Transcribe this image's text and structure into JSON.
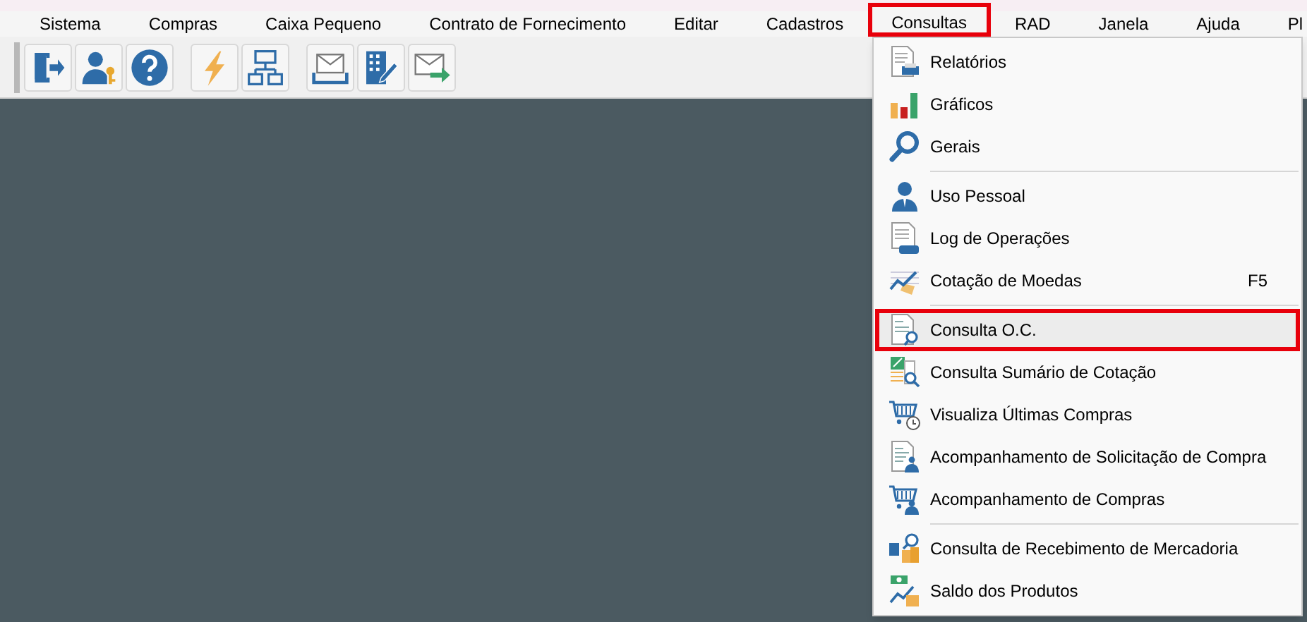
{
  "menu_bar": [
    {
      "label": "Sistema",
      "selected": false
    },
    {
      "label": "Compras",
      "selected": false
    },
    {
      "label": "Caixa Pequeno",
      "selected": false
    },
    {
      "label": "Contrato de Fornecimento",
      "selected": false
    },
    {
      "label": "Editar",
      "selected": false
    },
    {
      "label": "Cadastros",
      "selected": false
    },
    {
      "label": "Consultas",
      "selected": true
    },
    {
      "label": "RAD",
      "selected": false
    },
    {
      "label": "Janela",
      "selected": false
    },
    {
      "label": "Ajuda",
      "selected": false
    },
    {
      "label": "Pl",
      "selected": false
    }
  ],
  "toolbar": [
    {
      "kind": "exit"
    },
    {
      "kind": "user-key"
    },
    {
      "kind": "help"
    },
    {
      "kind": "gap"
    },
    {
      "kind": "lightning"
    },
    {
      "kind": "org-chart"
    },
    {
      "kind": "gap"
    },
    {
      "kind": "mail-tray"
    },
    {
      "kind": "building-pen"
    },
    {
      "kind": "mail-send"
    }
  ],
  "dropdown": [
    {
      "kind": "item",
      "label": "Relatórios",
      "selected": false
    },
    {
      "kind": "item",
      "label": "Gráficos",
      "selected": false
    },
    {
      "kind": "item",
      "label": "Gerais",
      "selected": false
    },
    {
      "kind": "separator"
    },
    {
      "kind": "item",
      "label": "Uso Pessoal",
      "selected": false
    },
    {
      "kind": "item",
      "label": "Log de Operações",
      "selected": false
    },
    {
      "kind": "item",
      "label": "Cotação de Moedas",
      "shortcut": "F5",
      "selected": false
    },
    {
      "kind": "separator"
    },
    {
      "kind": "item",
      "label": "Consulta O.C.",
      "selected": true
    },
    {
      "kind": "item",
      "label": "Consulta Sumário de Cotação",
      "selected": false
    },
    {
      "kind": "item",
      "label": "Visualiza Últimas Compras",
      "selected": false
    },
    {
      "kind": "item",
      "label": "Acompanhamento de Solicitação de Compra",
      "selected": false
    },
    {
      "kind": "item",
      "label": "Acompanhamento de Compras",
      "selected": false
    },
    {
      "kind": "separator"
    },
    {
      "kind": "item",
      "label": "Consulta de Recebimento de Mercadoria",
      "selected": false
    },
    {
      "kind": "item",
      "label": "Saldo dos Produtos",
      "selected": false
    }
  ]
}
